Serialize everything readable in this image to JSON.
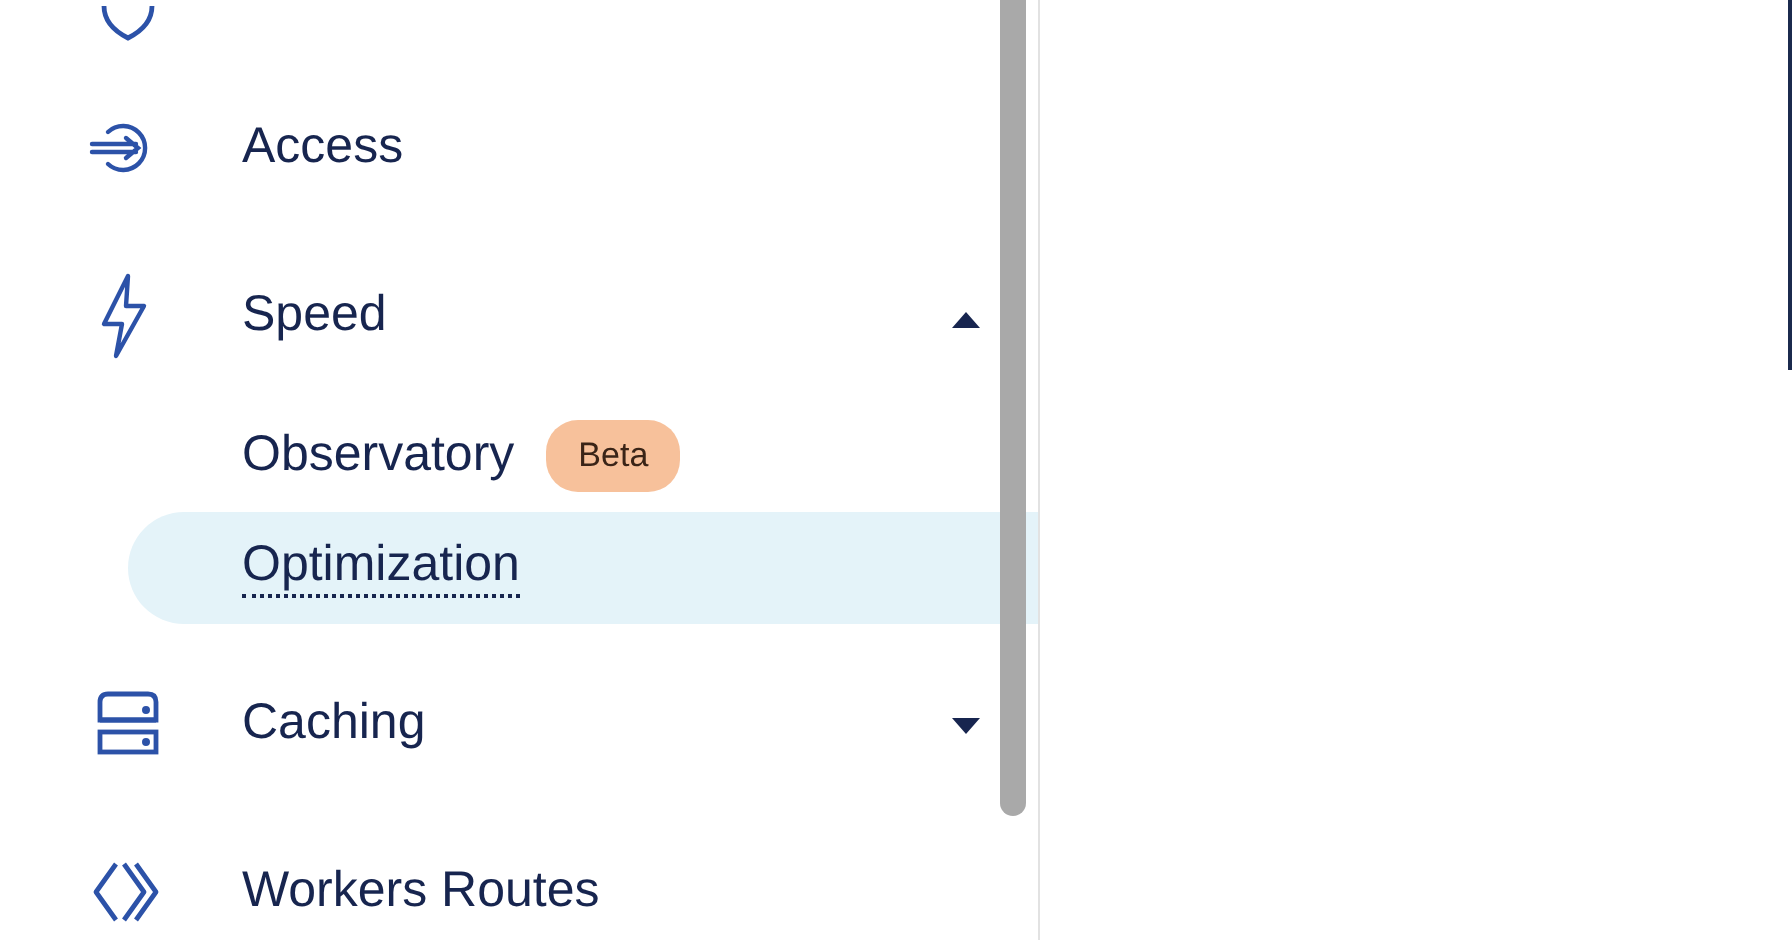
{
  "sidebar": {
    "items": [
      {
        "label": "Access"
      },
      {
        "label": "Speed",
        "expanded": true,
        "children": [
          {
            "label": "Observatory",
            "badge": "Beta",
            "selected": false
          },
          {
            "label": "Optimization",
            "selected": true
          }
        ]
      },
      {
        "label": "Caching",
        "expanded": false
      },
      {
        "label": "Workers Routes"
      }
    ]
  }
}
